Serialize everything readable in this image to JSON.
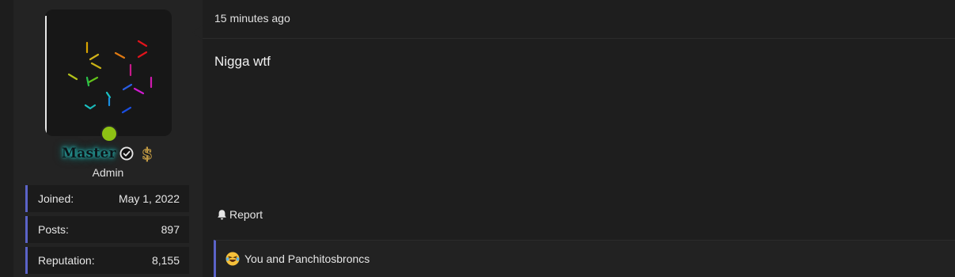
{
  "user": {
    "username": "Master",
    "title": "Admin",
    "stats": [
      {
        "label": "Joined:",
        "value": "May 1, 2022"
      },
      {
        "label": "Posts:",
        "value": "897"
      },
      {
        "label": "Reputation:",
        "value": "8,155"
      }
    ],
    "status": "online",
    "icons": {
      "verified": "verified-check-icon",
      "dollar": "dollar-badge-icon"
    },
    "colors": {
      "username_glow": "#2ec4c0",
      "online": "#8dc214",
      "accent": "#5b63c8"
    }
  },
  "message": {
    "timestamp": "15 minutes ago",
    "body": "Nigga wtf",
    "report_label": "Report",
    "reactions_text": "You and Panchitosbroncs",
    "reaction_icon": "laughing-emoji-icon"
  }
}
